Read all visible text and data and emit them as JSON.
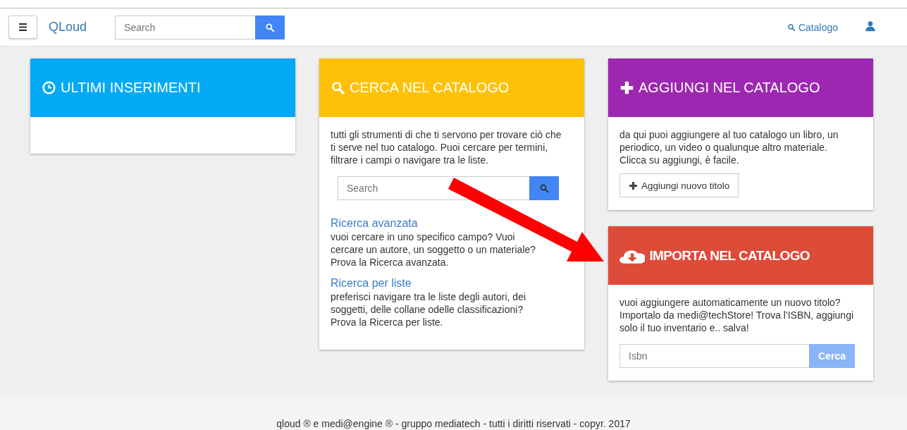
{
  "navbar": {
    "brand": "QLoud",
    "search": {
      "placeholder": "Search"
    },
    "links": [
      {
        "label": "Catalogo"
      }
    ]
  },
  "columns": [
    {
      "cards": [
        {
          "kind": "recent",
          "title": "ULTIMI INSERIMENTI",
          "color": "#03a9f4"
        }
      ]
    },
    {
      "cards": [
        {
          "kind": "search",
          "title": "CERCA NEL CATALOGO",
          "color": "#ffc107",
          "blocks": [
            {
              "kind": "text",
              "text": "tutti gli strumenti di che ti servono per trovare ciò che ti serve nel tuo catalogo. Puoi cercare per termini, filtrare i campi o navigare tra le liste."
            },
            {
              "kind": "search",
              "placeholder": "Search"
            },
            {
              "kind": "section",
              "link": "Ricerca avanzata",
              "text": "vuoi cercare in uno specifico campo? Vuoi cercare un autore, un soggetto o un materiale? Prova la Ricerca avanzata."
            },
            {
              "kind": "section",
              "link": "Ricerca per liste",
              "text": "preferisci navigare tra le liste degli autori, dei soggetti, delle collane odelle classificazioni? Prova la Ricerca per liste."
            }
          ]
        }
      ]
    },
    {
      "cards": [
        {
          "kind": "add",
          "title": "AGGIUNGI NEL CATALOGO",
          "color": "#9c27b0",
          "blocks": [
            {
              "kind": "text",
              "text": "da qui puoi aggiungere al tuo catalogo un libro, un periodico, un video o qualunque altro materiale. Clicca su aggiungi, è facile."
            },
            {
              "kind": "button",
              "label": "Aggiungi nuovo titolo"
            }
          ]
        },
        {
          "kind": "import",
          "title": "IMPORTA NEL CATALOGO",
          "color": "#dd4b39",
          "blocks": [
            {
              "kind": "text",
              "text": "vuoi aggiungere automaticamente un nuovo titolo? Importalo da medi@techStore! Trova l'ISBN, aggiungi solo il tuo inventario e.. salva!"
            },
            {
              "kind": "input_group",
              "placeholder": "Isbn",
              "button": "Cerca"
            }
          ]
        }
      ]
    }
  ],
  "footer": "qloud ® e medi@engine ® - gruppo mediatech - tutti i diritti riservati - copyr. 2017"
}
